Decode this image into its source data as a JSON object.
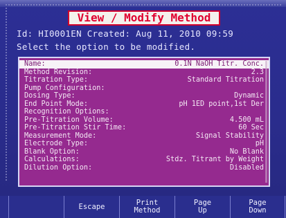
{
  "title": "View / Modify Method",
  "info": {
    "line1": "Id: HI0001EN  Created: Aug 11, 2010 09:59",
    "line2": "Select the option to be modified."
  },
  "options": [
    {
      "label": "Name:",
      "value": "0.1N NaOH Titr. Conc.",
      "selected": true
    },
    {
      "label": "Method Revision:",
      "value": "2.3"
    },
    {
      "label": "Titration Type:",
      "value": "Standard Titration"
    },
    {
      "label": "Pump Configuration:",
      "value": ""
    },
    {
      "label": "Dosing Type:",
      "value": "Dynamic"
    },
    {
      "label": "End Point Mode:",
      "value": "pH 1ED point,1st Der"
    },
    {
      "label": "Recognition Options:",
      "value": ""
    },
    {
      "label": "Pre-Titration Volume:",
      "value": "4.500 mL"
    },
    {
      "label": "Pre-Titration Stir Time:",
      "value": "60 Sec"
    },
    {
      "label": "Measurement Mode:",
      "value": "Signal Stability"
    },
    {
      "label": "Electrode Type:",
      "value": "pH"
    },
    {
      "label": "Blank Option:",
      "value": "No Blank"
    },
    {
      "label": "Calculations:",
      "value": "Stdz. Titrant by Weight"
    },
    {
      "label": "Dilution Option:",
      "value": "Disabled"
    }
  ],
  "softkeys": [
    {
      "line1": "",
      "line2": ""
    },
    {
      "line1": "Escape",
      "line2": ""
    },
    {
      "line1": "Print",
      "line2": "Method"
    },
    {
      "line1": "Page",
      "line2": "Up"
    },
    {
      "line1": "Page",
      "line2": "Down"
    }
  ]
}
